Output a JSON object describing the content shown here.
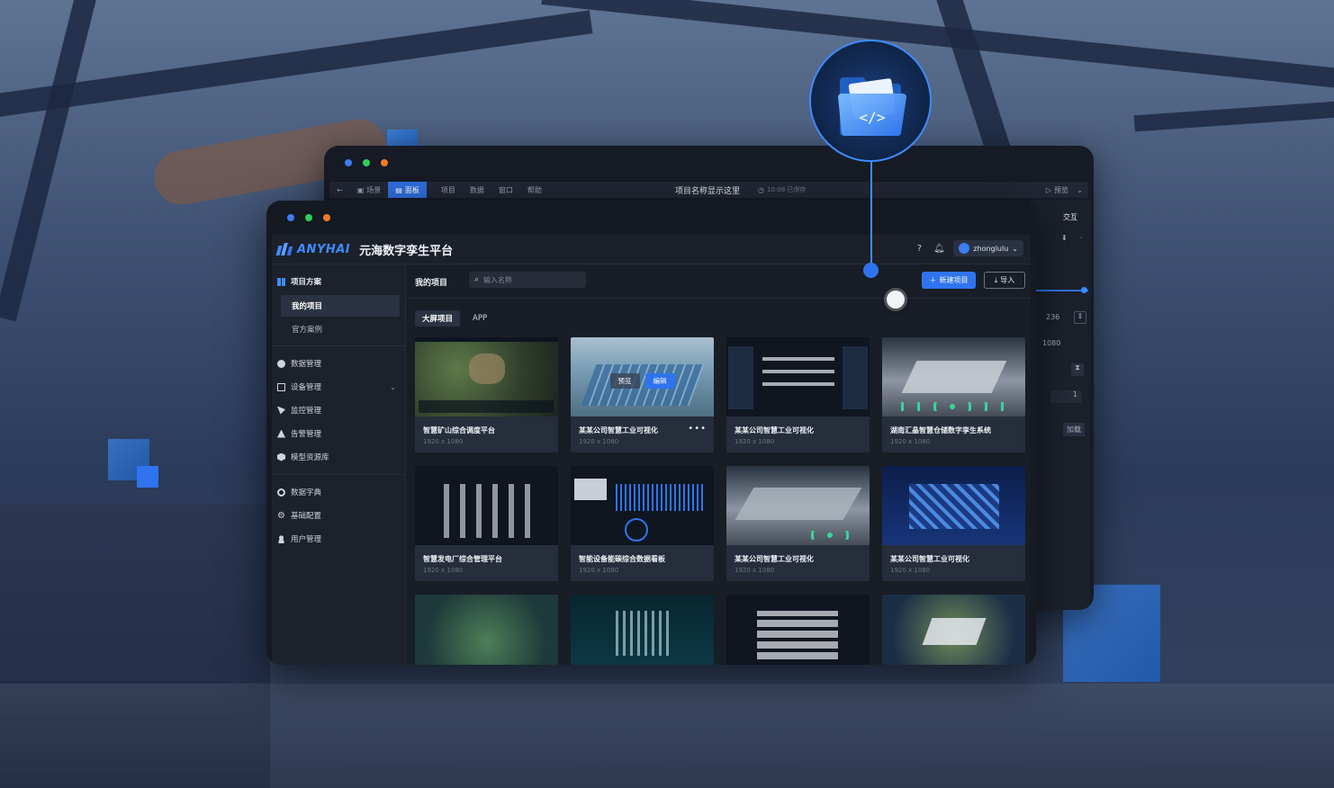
{
  "back_window": {
    "toolbar": {
      "scene": "场景",
      "panel": "面板",
      "project": "项目",
      "data": "数据",
      "window": "窗口",
      "help": "帮助",
      "project_name": "项目名称显示这里",
      "saved": "10:08 已保存",
      "preview": "预览"
    },
    "right_panel": {
      "interact": "交互",
      "width": "236",
      "height": "1080",
      "value": "1",
      "load": "加载"
    }
  },
  "app": {
    "logo_text": "ANYHAI",
    "platform_title": "元海数字孪生平台",
    "username": "zhonglulu",
    "colors": {
      "accent": "#2f74ee",
      "brand": "#3d8bff",
      "bg": "#181d26"
    }
  },
  "sidebar": {
    "group_label": "项目方案",
    "sub_items": [
      {
        "label": "我的项目",
        "active": true
      },
      {
        "label": "官方案例",
        "active": false
      }
    ],
    "items": [
      {
        "label": "数据管理",
        "icon": "cloud-icon"
      },
      {
        "label": "设备管理",
        "icon": "device-icon"
      },
      {
        "label": "监控管理",
        "icon": "monitor-icon"
      },
      {
        "label": "告警管理",
        "icon": "alarm-icon"
      },
      {
        "label": "模型资源库",
        "icon": "cube-icon"
      }
    ],
    "items2": [
      {
        "label": "数据字典",
        "icon": "dictionary-icon"
      },
      {
        "label": "基础配置",
        "icon": "gear-icon"
      },
      {
        "label": "用户管理",
        "icon": "user-icon"
      }
    ]
  },
  "main": {
    "title": "我的项目",
    "search_placeholder": "输入名称",
    "new_button": "新建项目",
    "import_button": "导入",
    "tabs": [
      {
        "label": "大屏项目",
        "active": true
      },
      {
        "label": "APP",
        "active": false
      }
    ],
    "hover_actions": {
      "preview": "预览",
      "edit": "编辑"
    },
    "cards": [
      {
        "title": "智慧矿山综合调度平台",
        "size": "1920 x 1080"
      },
      {
        "title": "某某公司智慧工业可视化",
        "size": "1920 x 1080"
      },
      {
        "title": "某某公司智慧工业可视化",
        "size": "1920 x 1080"
      },
      {
        "title": "湖南汇晶智慧仓储数字孪生系统",
        "size": "1920 x 1080"
      },
      {
        "title": "智慧发电厂综合管理平台",
        "size": "1920 x 1080"
      },
      {
        "title": "智能设备能碳综合数据看板",
        "size": "1920 x 1080"
      },
      {
        "title": "某某公司智慧工业可视化",
        "size": "1920 x 1080"
      },
      {
        "title": "某某公司智慧工业可视化",
        "size": "1920 x 1080"
      },
      {
        "title": "",
        "size": ""
      },
      {
        "title": "",
        "size": ""
      },
      {
        "title": "",
        "size": ""
      },
      {
        "title": "",
        "size": ""
      }
    ]
  }
}
